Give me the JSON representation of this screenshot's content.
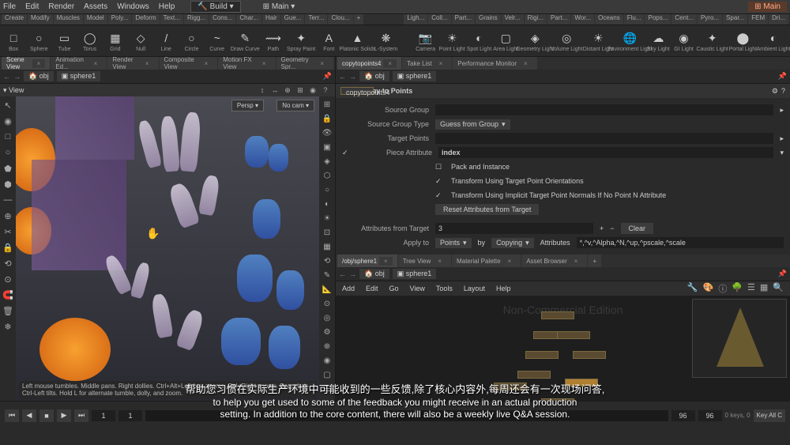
{
  "menubar": [
    "File",
    "Edit",
    "Render",
    "Assets",
    "Windows",
    "Help"
  ],
  "build": "Build",
  "main_dropdown": "Main",
  "main_tab": "Main",
  "shelf_tabs": [
    "Create",
    "Modify",
    "Muscles",
    "Model",
    "Poly...",
    "Deform",
    "Text...",
    "Rigg...",
    "Cons...",
    "Char...",
    "Hair",
    "Gue...",
    "Terr...",
    "Clou...",
    "+"
  ],
  "shelf_tabs2": [
    "Ligh...",
    "Coll...",
    "Part...",
    "Grains",
    "Velr...",
    "Rigi...",
    "Part...",
    "Wor...",
    "Oceans",
    "Flu...",
    "Pops...",
    "Cent...",
    "Pyro...",
    "Spar...",
    "FEM",
    "Dri..."
  ],
  "shelf_items": [
    {
      "icon": "□",
      "lbl": "Box"
    },
    {
      "icon": "○",
      "lbl": "Sphere"
    },
    {
      "icon": "▭",
      "lbl": "Tube"
    },
    {
      "icon": "◯",
      "lbl": "Torus"
    },
    {
      "icon": "▦",
      "lbl": "Grid"
    },
    {
      "icon": "◇",
      "lbl": "Null"
    },
    {
      "icon": "/",
      "lbl": "Line"
    },
    {
      "icon": "○",
      "lbl": "Circle"
    },
    {
      "icon": "~",
      "lbl": "Curve"
    },
    {
      "icon": "✎",
      "lbl": "Draw Curve"
    },
    {
      "icon": "⟿",
      "lbl": "Path"
    },
    {
      "icon": "✦",
      "lbl": "Spray Paint"
    },
    {
      "icon": "A",
      "lbl": "Font"
    },
    {
      "icon": "▲",
      "lbl": "Platonic Solids"
    },
    {
      "icon": "❋",
      "lbl": "L-System"
    }
  ],
  "shelf_items2": [
    {
      "icon": "📷",
      "lbl": "Camera"
    },
    {
      "icon": "☀",
      "lbl": "Point Light"
    },
    {
      "icon": "◐",
      "lbl": "Spot Light"
    },
    {
      "icon": "▢",
      "lbl": "Area Light"
    },
    {
      "icon": "◈",
      "lbl": "Geometry Light"
    },
    {
      "icon": "◎",
      "lbl": "Volume Light"
    },
    {
      "icon": "☀",
      "lbl": "Distant Light"
    },
    {
      "icon": "🌐",
      "lbl": "Environment Light"
    },
    {
      "icon": "☁",
      "lbl": "Sky Light"
    },
    {
      "icon": "◉",
      "lbl": "GI Light"
    },
    {
      "icon": "✦",
      "lbl": "Caustic Light"
    },
    {
      "icon": "⬤",
      "lbl": "Portal Light"
    },
    {
      "icon": "◐",
      "lbl": "Ambient Light"
    }
  ],
  "left_tabs": [
    "Scene View",
    "Animation Ed...",
    "Render View",
    "Composite View",
    "Motion FX View",
    "Geometry Spr..."
  ],
  "right_tabs_top": [
    "copytopoints4",
    "Take List",
    "Performance Monitor"
  ],
  "right_tabs_bot": [
    "/obj/sphere1",
    "Tree View",
    "Material Palette",
    "Asset Browser",
    "+"
  ],
  "path_left": {
    "obj": "obj",
    "node": "sphere1"
  },
  "path_right": {
    "obj": "obj",
    "node": "sphere1"
  },
  "view_label": "View",
  "persp_btn": "Persp ▾",
  "nocam_btn": "No cam ▾",
  "status_viewport": "Left mouse tumbles. Middle pans. Right dollies. Ctrl+Alt+Left box-zooms. Ctrl+Right zooms. Spacebar-Ctrl-Left tilts. Hold L for alternate tumble, dolly, and zoom.",
  "watermark": "Non-Commercial Edition",
  "param": {
    "title": "Copy to Points",
    "node": "copytopoints4",
    "source_group": "Source Group",
    "source_group_type": "Source Group Type",
    "source_group_type_val": "Guess from Group",
    "target_points": "Target Points",
    "piece_attr": "Piece Attribute",
    "piece_attr_val": "index",
    "pack_instance": "Pack and Instance",
    "transform_orient": "Transform Using Target Point Orientations",
    "transform_implicit": "Transform Using Implicit Target Point Normals If No Point N Attribute",
    "reset_btn": "Reset Attributes from Target",
    "attrs_target": "Attributes from Target",
    "attrs_target_val": "3",
    "clear_btn": "Clear",
    "apply_to": "Apply to",
    "apply_to_val": "Points",
    "by": "by",
    "by_val": "Copying",
    "attributes": "Attributes",
    "attributes_val": "*,^v,^Alpha,^N,^up,^pscale,^scale"
  },
  "net_menu": [
    "Add",
    "Edit",
    "Go",
    "View",
    "Tools",
    "Layout",
    "Help"
  ],
  "timeline": {
    "frame": "1",
    "start": "1",
    "end1": "96",
    "end2": "96",
    "keys": "0 keys, 0"
  },
  "key_all": "Key All C",
  "subtitle_cn": "帮助您习惯在实际生产环境中可能收到的一些反馈,除了核心内容外,每周还会有一次现场问答,",
  "subtitle_en1": "to help you get used to some of the feedback you might receive in an actual production",
  "subtitle_en2": "setting. In addition to the core content, there will also be a weekly live Q&A session."
}
